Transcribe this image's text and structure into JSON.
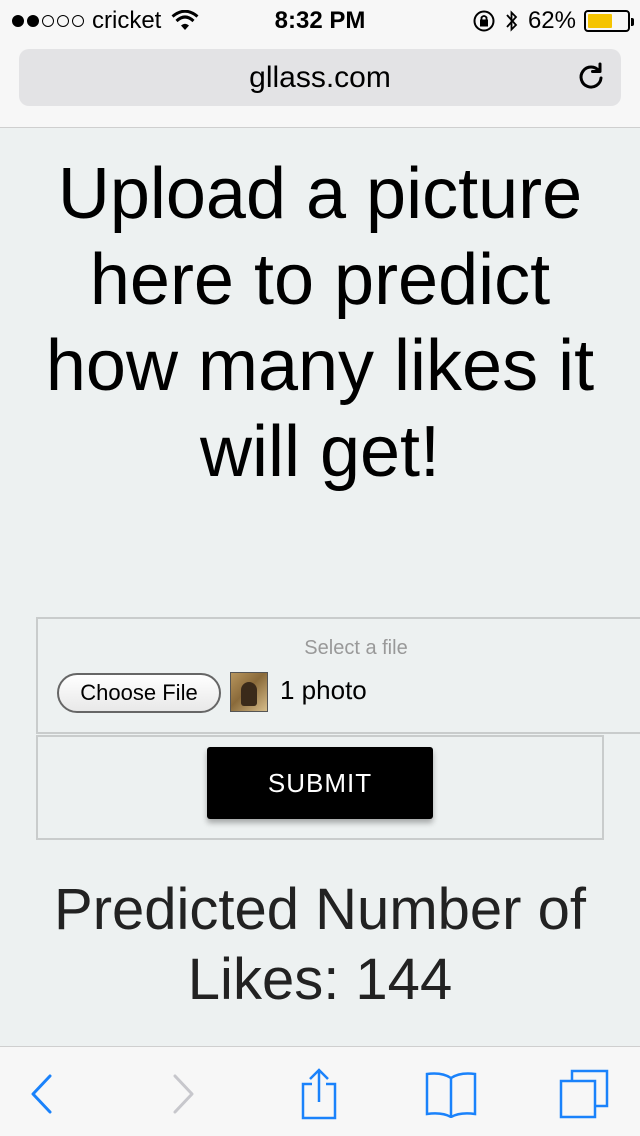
{
  "status_bar": {
    "carrier": "cricket",
    "time": "8:32 PM",
    "battery_percent": "62%",
    "battery_level": 0.62,
    "signal_bars_filled": 2,
    "signal_bars_total": 5
  },
  "browser": {
    "url": "gllass.com"
  },
  "page": {
    "headline": "Upload a picture here to predict how many likes it will get!",
    "select_label": "Select a file",
    "choose_file_label": "Choose File",
    "photo_count": "1 photo",
    "submit_label": "SUBMIT",
    "prediction_line1": "Predicted Number of",
    "prediction_line2": "Likes: 144"
  },
  "colors": {
    "page_background": "#edf1f1",
    "accent_blue": "#1a82fb",
    "submit_background": "#000000",
    "battery_fill": "#f5c400"
  },
  "icons": {
    "reload": "reload-icon",
    "back": "back-chevron-icon",
    "forward": "forward-chevron-icon",
    "share": "share-icon",
    "bookmarks": "bookmarks-icon",
    "tabs": "tabs-icon"
  }
}
